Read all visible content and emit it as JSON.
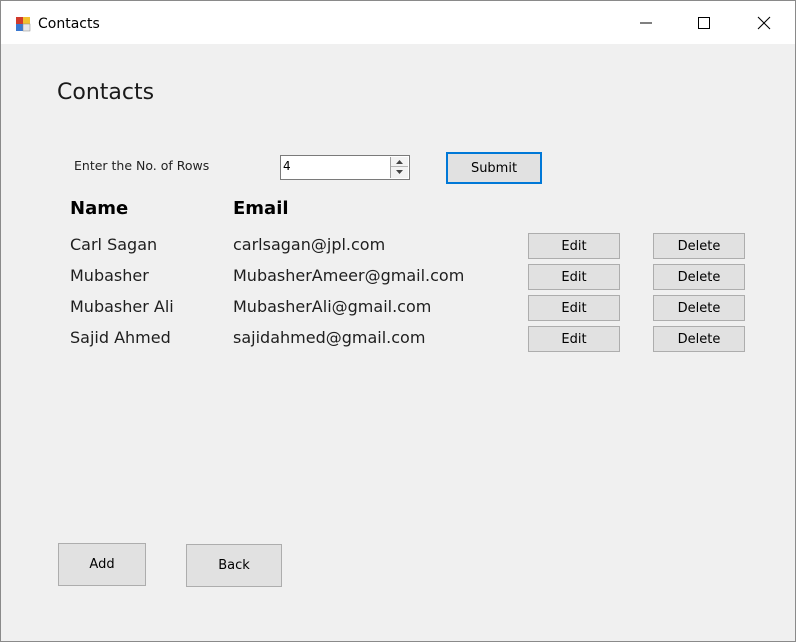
{
  "window": {
    "title": "Contacts"
  },
  "page": {
    "heading": "Contacts"
  },
  "rows_input": {
    "label": "Enter the No. of Rows",
    "value": "4",
    "submit_label": "Submit"
  },
  "table": {
    "headers": [
      "Name",
      "Email"
    ],
    "rows": [
      {
        "name": "Carl Sagan",
        "email": "carlsagan@jpl.com",
        "edit": "Edit",
        "delete": "Delete"
      },
      {
        "name": "Mubasher",
        "email": "MubasherAmeer@gmail.com",
        "edit": "Edit",
        "delete": "Delete"
      },
      {
        "name": "Mubasher Ali",
        "email": "MubasherAli@gmail.com",
        "edit": "Edit",
        "delete": "Delete"
      },
      {
        "name": "Sajid Ahmed",
        "email": "sajidahmed@gmail.com",
        "edit": "Edit",
        "delete": "Delete"
      }
    ]
  },
  "footer": {
    "add_label": "Add",
    "back_label": "Back"
  },
  "icons": {
    "app": "app-window-icon",
    "minimize": "minimize-icon",
    "maximize": "maximize-icon",
    "close": "close-icon"
  },
  "colors": {
    "focus_border": "#0078d7",
    "button_bg": "#e1e1e1",
    "form_bg": "#f0f0f0"
  }
}
